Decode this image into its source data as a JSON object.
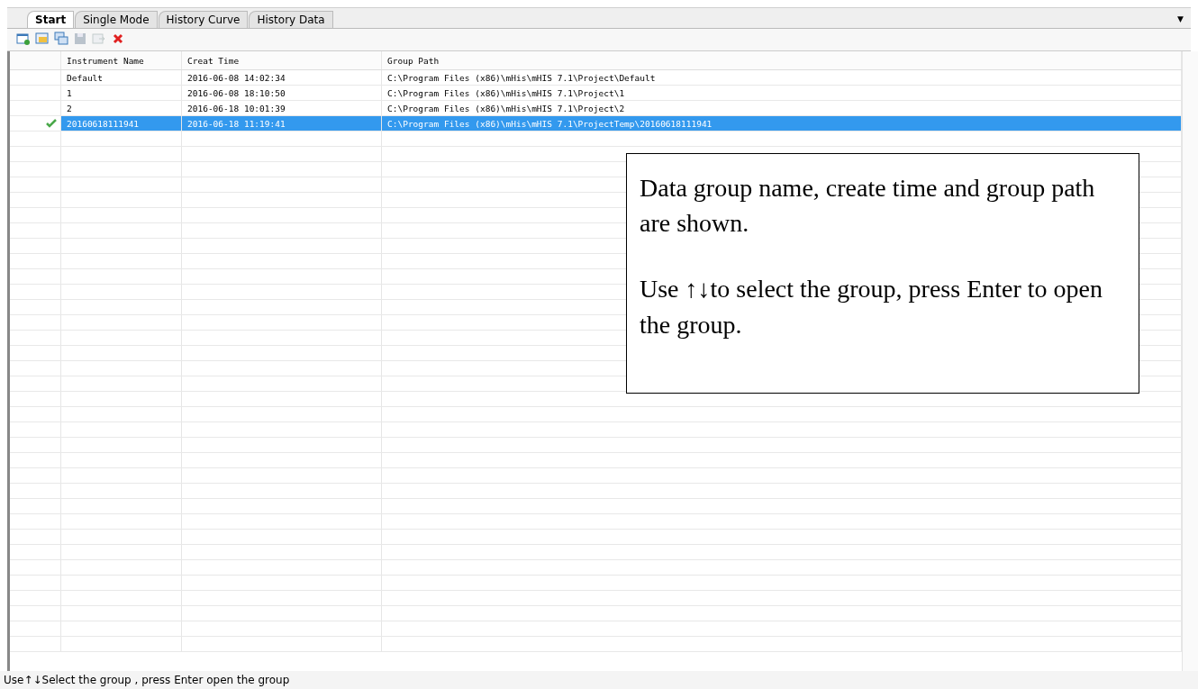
{
  "tabs": [
    {
      "label": "Start",
      "selected": true
    },
    {
      "label": "Single Mode",
      "selected": false
    },
    {
      "label": "History Curve",
      "selected": false
    },
    {
      "label": "History Data",
      "selected": false
    }
  ],
  "tab_menu": "▼",
  "toolbar": [
    {
      "kind": "new",
      "disabled": false
    },
    {
      "kind": "open",
      "disabled": false
    },
    {
      "kind": "windows",
      "disabled": false
    },
    {
      "kind": "save",
      "disabled": true
    },
    {
      "kind": "export",
      "disabled": true
    },
    {
      "kind": "delete",
      "disabled": false
    }
  ],
  "table": {
    "columns": [
      "Instrument Name",
      "Creat Time",
      "Group Path"
    ],
    "rows": [
      {
        "cells": [
          "Default",
          "2016-06-08 14:02:34",
          "C:\\Program Files (x86)\\mHis\\mHIS 7.1\\Project\\Default"
        ],
        "selected": false,
        "checked": false
      },
      {
        "cells": [
          "1",
          "2016-06-08 18:10:50",
          "C:\\Program Files (x86)\\mHis\\mHIS 7.1\\Project\\1"
        ],
        "selected": false,
        "checked": false
      },
      {
        "cells": [
          "2",
          "2016-06-18 10:01:39",
          "C:\\Program Files (x86)\\mHis\\mHIS 7.1\\Project\\2"
        ],
        "selected": false,
        "checked": false
      },
      {
        "cells": [
          "20160618111941",
          "2016-06-18 11:19:41",
          "C:\\Program Files (x86)\\mHis\\mHIS 7.1\\ProjectTemp\\20160618111941"
        ],
        "selected": true,
        "checked": true
      }
    ]
  },
  "callout": {
    "paragraphs": [
      "Data group name, create time and group path are shown.",
      "Use ↑↓to select the group, press Enter  to open the group."
    ]
  },
  "status_bar": "Use↑↓Select the group , press Enter open the group"
}
